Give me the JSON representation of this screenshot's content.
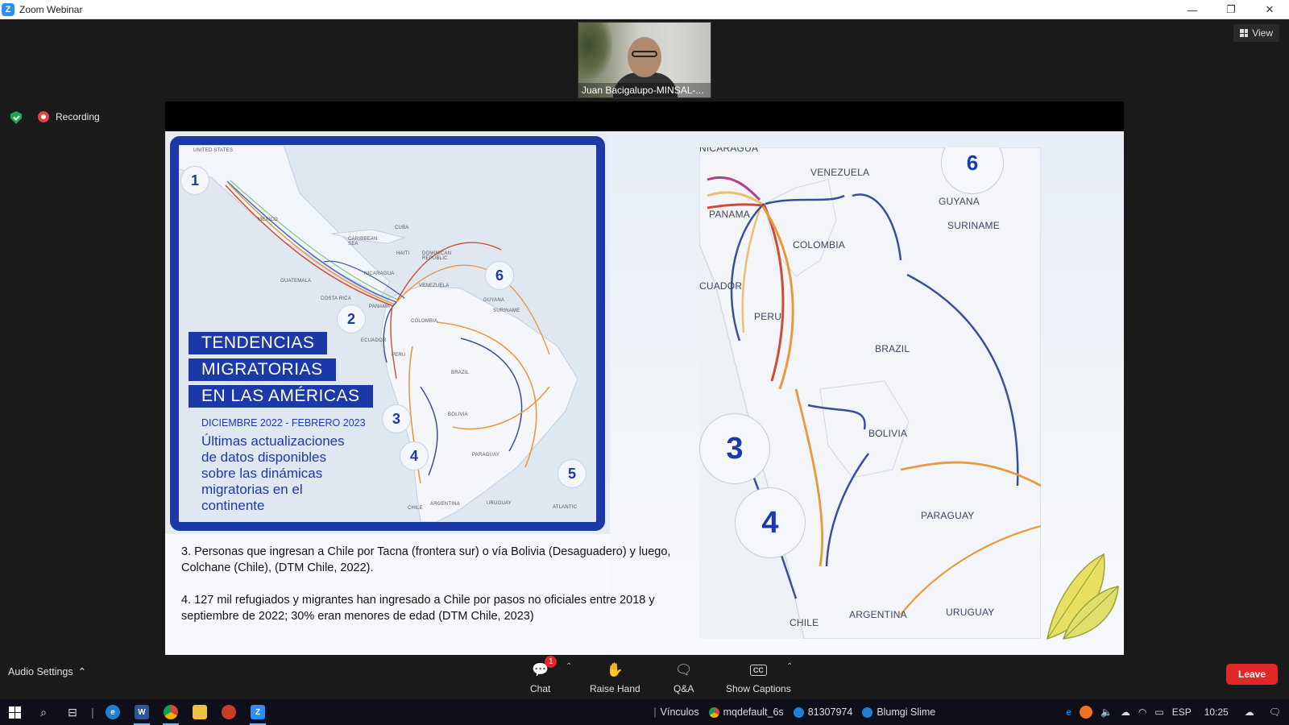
{
  "window": {
    "title": "Zoom Webinar",
    "controls": {
      "minimize": "—",
      "restore": "❐",
      "close": "✕"
    }
  },
  "meeting": {
    "view_label": "View",
    "recording_label": "Recording",
    "participant_name": "Juan Bacigalupo-MINSAL-..."
  },
  "slide": {
    "left_map": {
      "title_lines": [
        "TENDENCIAS",
        "MIGRATORIAS",
        "EN LAS AMÉRICAS"
      ],
      "date_range": "DICIEMBRE 2022 - FEBRERO 2023",
      "description": "Últimas actualizaciones de datos disponibles sobre las dinámicas migratorias en el continente",
      "route_numbers": [
        "1",
        "2",
        "3",
        "4",
        "5",
        "6"
      ],
      "labels": {
        "united_states": "UNITED STATES",
        "mexico": "MEXICO",
        "cuba": "CUBA",
        "caribbean": "CARIBBEAN SEA",
        "haiti": "HAITI",
        "dominican": "DOMINICAN REPUBLIC",
        "guatemala": "GUATEMALA",
        "nicaragua": "NICARAGUA",
        "costa_rica": "COSTA RICA",
        "panama": "PANAMA",
        "venezuela": "VENEZUELA",
        "guyana": "GUYANA",
        "suriname": "SURINAME",
        "colombia": "COLOMBIA",
        "ecuador": "ECUADOR",
        "peru": "PERU",
        "brazil": "BRAZIL",
        "bolivia": "BOLIVIA",
        "paraguay": "PARAGUAY",
        "chile": "CHILE",
        "argentina": "ARGENTINA",
        "uruguay": "URUGUAY",
        "atlantic": "ATLANTIC"
      }
    },
    "right_map": {
      "labels": {
        "nicaragua": "NICARAGUA",
        "venezuela": "VENEZUELA",
        "guyana": "GUYANA",
        "suriname": "SURINAME",
        "panama": "PANAMA",
        "colombia": "COLOMBIA",
        "ecuador": "CUADOR",
        "peru": "PERU",
        "brazil": "BRAZIL",
        "bolivia": "BOLIVIA",
        "paraguay": "PARAGUAY",
        "chile": "CHILE",
        "argentina": "ARGENTINA",
        "uruguay": "URUGUAY"
      },
      "route_numbers": [
        "6",
        "3",
        "4"
      ]
    },
    "notes": [
      "3. Personas que ingresan a Chile por Tacna (frontera sur) o vía Bolivia (Desaguadero) y luego, Colchane (Chile), (DTM Chile, 2022).",
      "4. 127 mil refugiados y migrantes han ingresado a Chile por pasos no oficiales entre 2018 y septiembre de 2022; 30% eran menores de edad (DTM Chile, 2023)"
    ]
  },
  "toolbar": {
    "audio_settings": "Audio Settings",
    "chat_label": "Chat",
    "chat_badge": "1",
    "raise_hand_label": "Raise Hand",
    "qa_label": "Q&A",
    "captions_label": "Show Captions",
    "captions_icon": "CC",
    "leave_label": "Leave"
  },
  "taskbar": {
    "links": [
      {
        "label": "Vínculos",
        "color": ""
      },
      {
        "label": "mqdefault_6s",
        "color": "#e0b020"
      },
      {
        "label": "81307974",
        "color": "#3c8ee0"
      },
      {
        "label": "Blumgi Slime",
        "color": "#3c8ee0"
      }
    ],
    "language": "ESP",
    "time": "10:25",
    "notification_badge": "1"
  },
  "colors": {
    "slide_blue": "#1b39a8",
    "leave_red": "#e02828",
    "recording_red": "#e0453a",
    "shield_green": "#23a455"
  }
}
